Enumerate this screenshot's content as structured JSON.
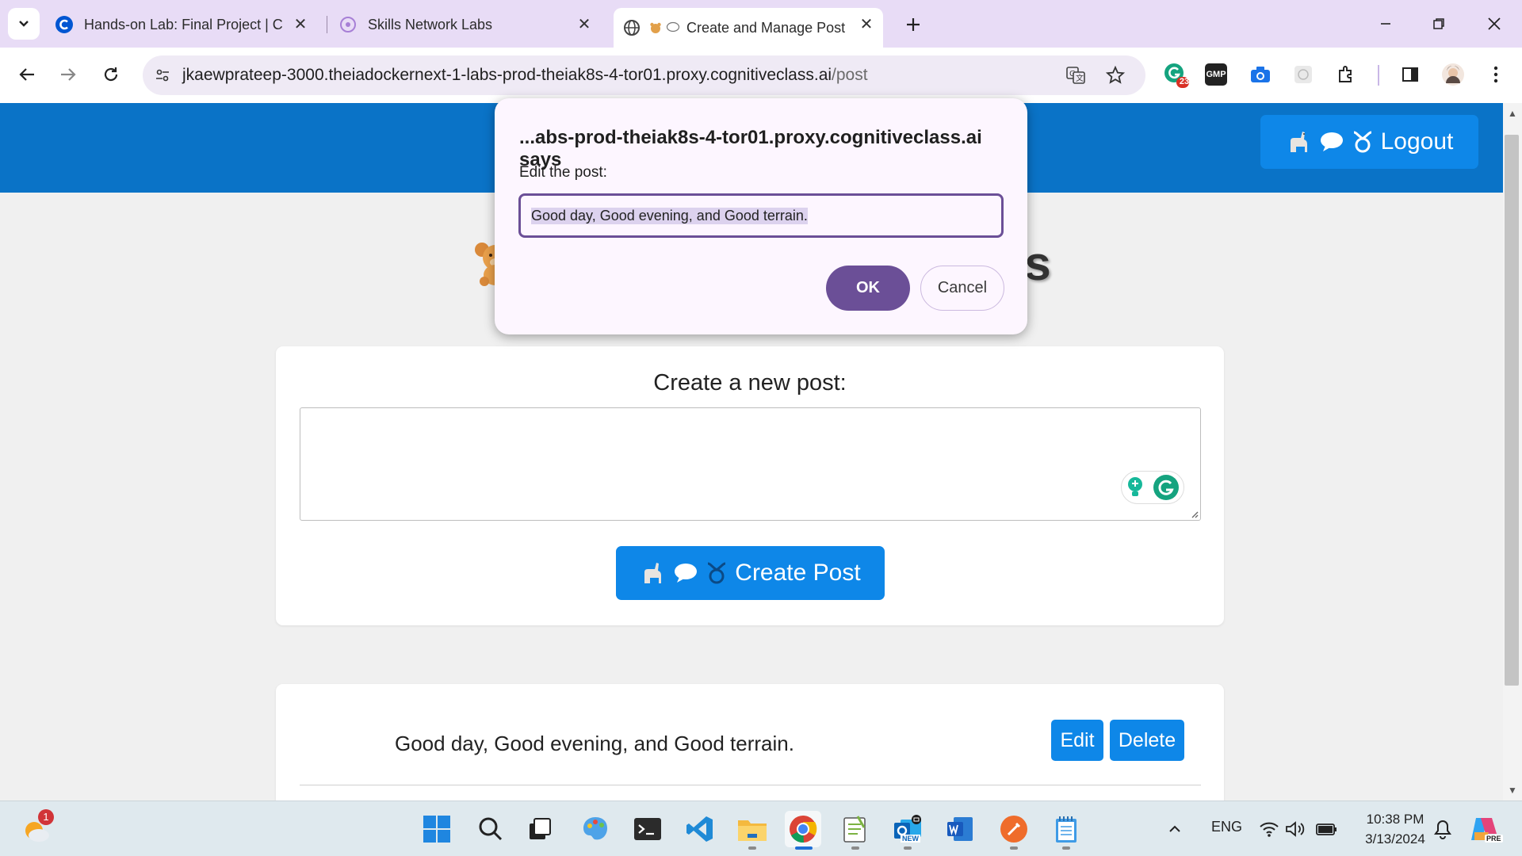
{
  "browser": {
    "tabs": [
      {
        "title": "Hands-on Lab: Final Project | Co",
        "favicon": "coursera-c-icon"
      },
      {
        "title": "Skills Network Labs",
        "favicon": "skills-network-icon"
      },
      {
        "title": "Create and Manage Post",
        "favicon": "globe-icon",
        "active": true
      }
    ],
    "url_host": "jkaewprateep-3000.theiadockernext-1-labs-prod-theiak8s-4-tor01.proxy.cognitiveclass.ai",
    "url_path": "/post",
    "extension_badge": "23",
    "gmp_label": "GMP"
  },
  "app": {
    "logout_label": "Logout",
    "heading_visible_text": "osts",
    "create_label": "Create a new post:",
    "create_button_label": "Create Post",
    "posts": [
      {
        "text": "Good day, Good evening, and Good terrain.",
        "edit_label": "Edit",
        "delete_label": "Delete"
      }
    ]
  },
  "dialog": {
    "title": "...abs-prod-theiak8s-4-tor01.proxy.cognitiveclass.ai says",
    "message": "Edit the post:",
    "input_value": "Good day, Good evening, and Good terrain.",
    "ok_label": "OK",
    "cancel_label": "Cancel"
  },
  "taskbar": {
    "weather_badge": "1",
    "language": "ENG",
    "time": "10:38 PM",
    "date": "3/13/2024",
    "outlook_badge": "NEW",
    "copilot_badge": "PRE"
  }
}
